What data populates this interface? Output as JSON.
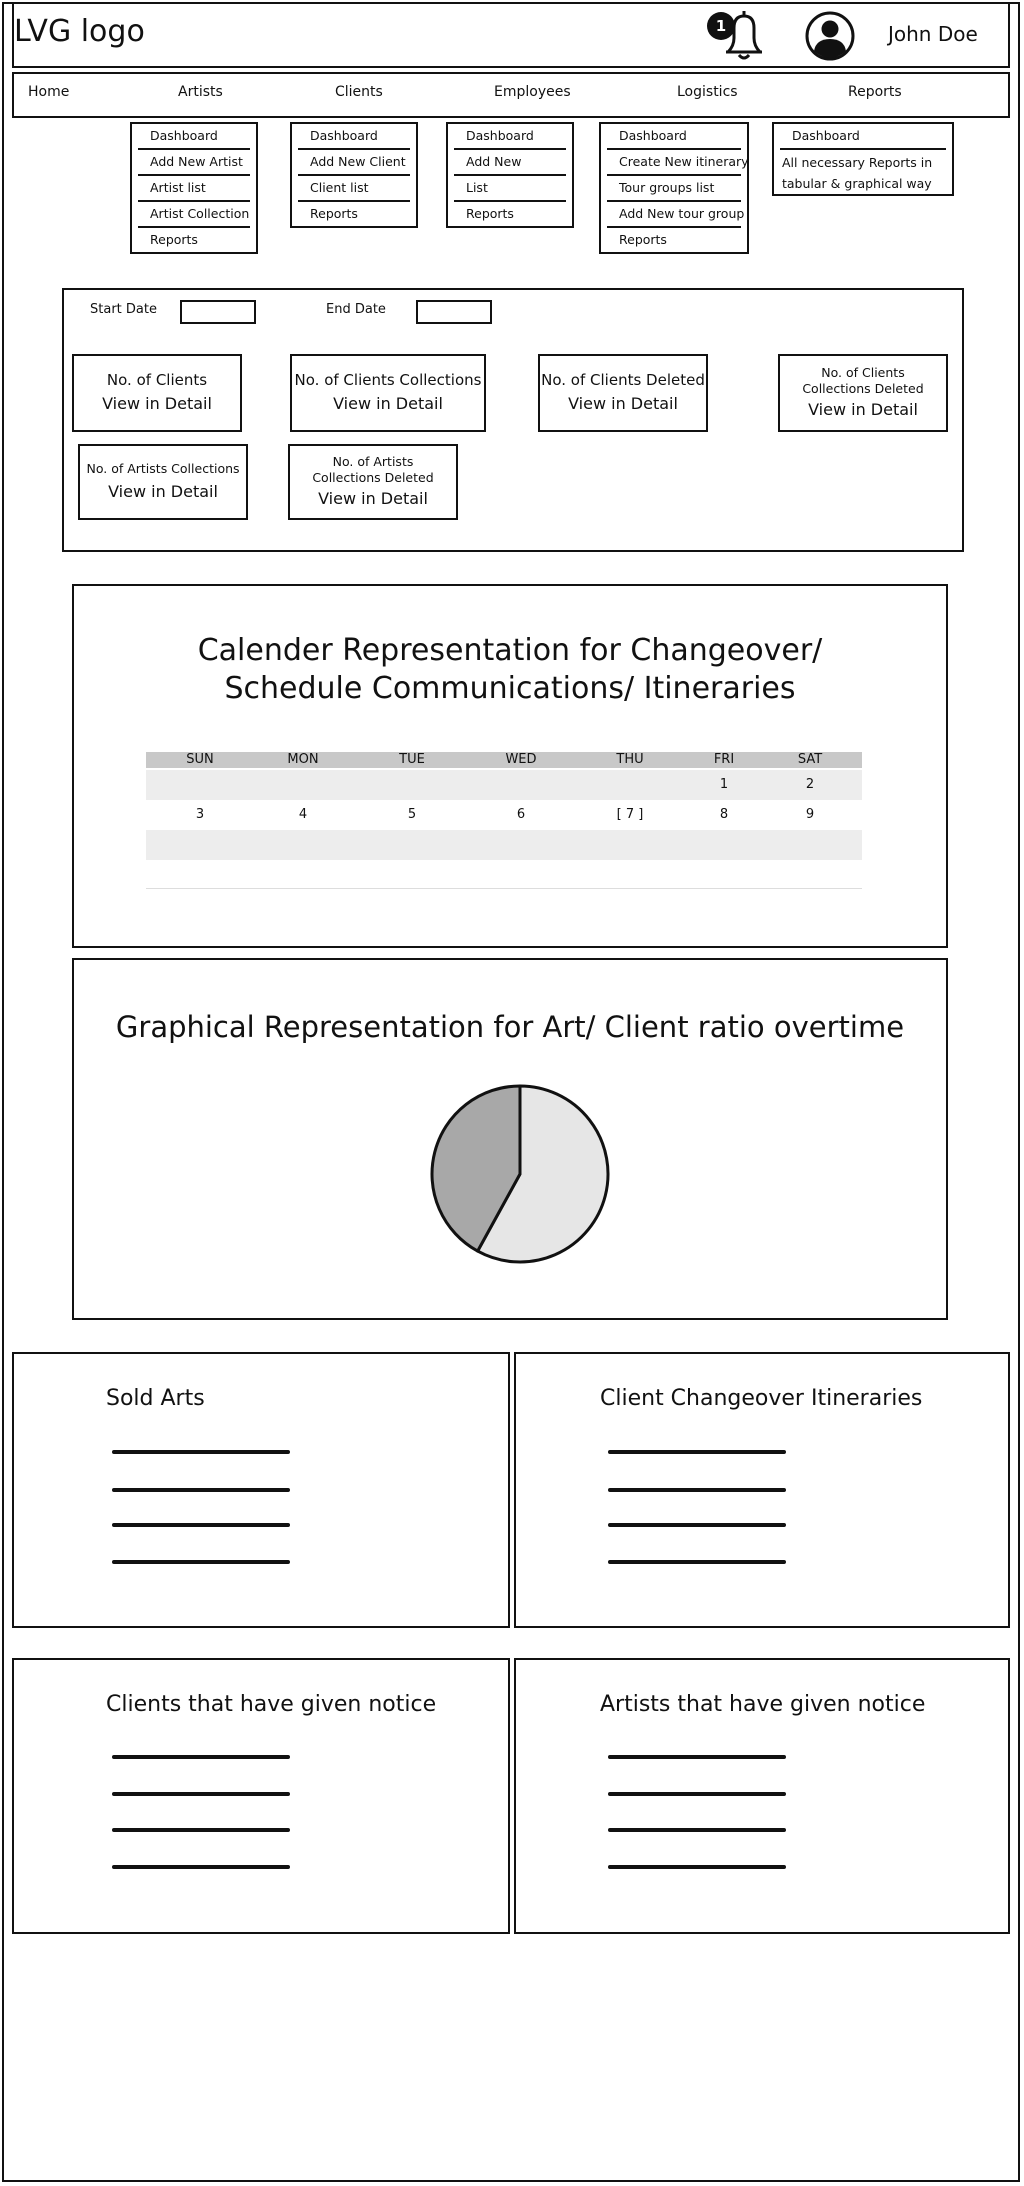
{
  "header": {
    "logo": "LVG logo",
    "notification_count": "1",
    "user_name": "John Doe"
  },
  "nav": {
    "items": [
      {
        "label": "Home"
      },
      {
        "label": "Artists",
        "submenu": [
          "Dashboard",
          "Add New Artist",
          "Artist list",
          "Artist Collection",
          "Reports"
        ]
      },
      {
        "label": "Clients",
        "submenu": [
          "Dashboard",
          "Add New Client",
          "Client list",
          "Reports"
        ]
      },
      {
        "label": "Employees",
        "submenu": [
          "Dashboard",
          "Add New",
          "List",
          "Reports"
        ]
      },
      {
        "label": "Logistics",
        "submenu": [
          "Dashboard",
          "Create New itinerary",
          "Tour groups list",
          "Add New tour group",
          "Reports"
        ]
      },
      {
        "label": "Reports",
        "submenu": [
          "Dashboard"
        ],
        "note": "All necessary Reports in tabular & graphical way"
      }
    ]
  },
  "filters": {
    "start_label": "Start Date",
    "start_value": "",
    "end_label": "End Date",
    "end_value": ""
  },
  "stat_cards": [
    {
      "title": "No. of Clients",
      "link": "View in Detail"
    },
    {
      "title": "No. of Clients Collections",
      "link": "View in Detail"
    },
    {
      "title": "No. of Clients Deleted",
      "link": "View in Detail"
    },
    {
      "title": "No. of Clients Collections Deleted",
      "link": "View in Detail"
    },
    {
      "title": "No. of Artists Collections",
      "link": "View in Detail"
    },
    {
      "title": "No. of Artists Collections Deleted",
      "link": "View in Detail"
    }
  ],
  "calendar": {
    "title_line1": "Calender Representation for Changeover/",
    "title_line2": "Schedule Communications/ Itineraries",
    "days": [
      "SUN",
      "MON",
      "TUE",
      "WED",
      "THU",
      "FRI",
      "SAT"
    ],
    "rows": [
      [
        "",
        "",
        "",
        "",
        "",
        "1",
        "2"
      ],
      [
        "3",
        "4",
        "5",
        "6",
        "[ 7 ]",
        "8",
        "9"
      ]
    ]
  },
  "ratio_chart": {
    "title": "Graphical Representation for Art/ Client ratio overtime"
  },
  "chart_data": {
    "type": "pie",
    "title": "Graphical Representation for Art/ Client ratio overtime",
    "values": [
      58,
      42
    ],
    "colors": [
      "#e6e6e6",
      "#a8a8a8"
    ]
  },
  "lists": {
    "sold_arts": "Sold Arts",
    "client_changeover": "Client Changeover Itineraries",
    "clients_notice": "Clients that have given notice",
    "artists_notice": "Artists that have given notice"
  }
}
